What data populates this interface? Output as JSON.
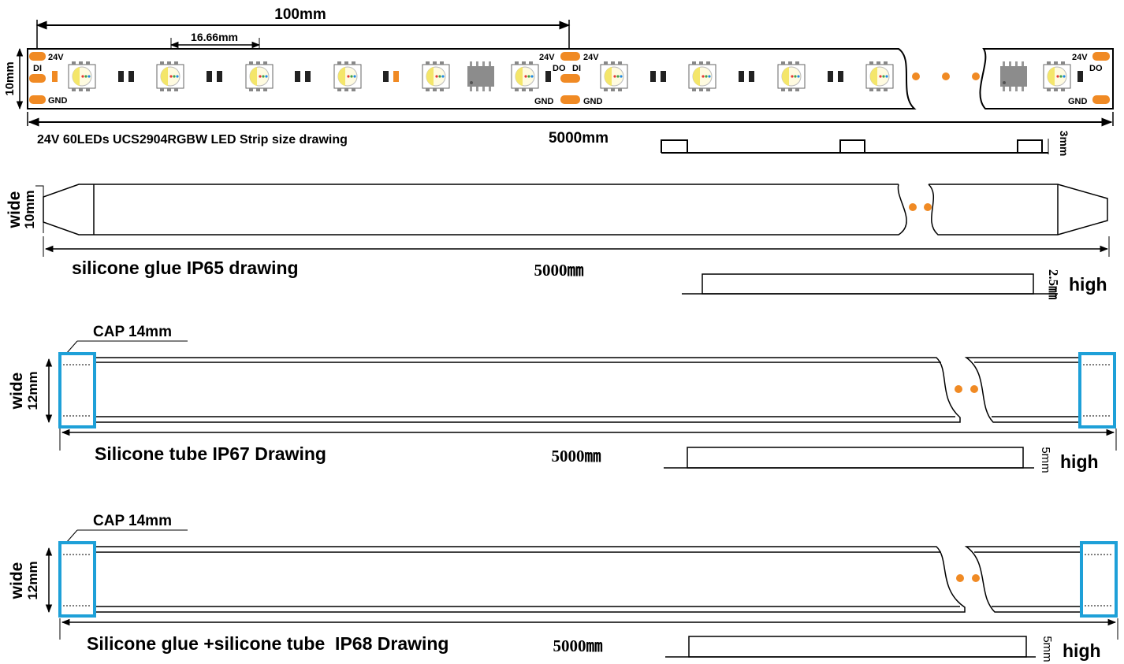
{
  "strip": {
    "dim_100": "100mm",
    "dim_pitch": "16.66mm",
    "dim_width": "10mm",
    "dim_total": "5000mm",
    "dim_thickness": "3mm",
    "caption": "24V 60LEDs UCS2904RGBW LED Strip size drawing",
    "pad_24v": "24V",
    "pad_di": "DI",
    "pad_do": "DO",
    "pad_gnd": "GND"
  },
  "ip65": {
    "width_value": "10mm",
    "width_word": "wide",
    "title": "silicone glue IP65 drawing",
    "length": "5000㎜",
    "height_value": "2.5㎜",
    "height_word": "high"
  },
  "ip67": {
    "cap": "CAP 14mm",
    "width_value": "12mm",
    "width_word": "wide",
    "title": "Silicone tube IP67 Drawing",
    "length": "5000㎜",
    "height_value": "5mm",
    "height_word": "high"
  },
  "ip68": {
    "cap": "CAP 14mm",
    "width_value": "12mm",
    "width_word": "wide",
    "title": "Silicone glue +silicone tube  IP68 Drawing",
    "length": "5000㎜",
    "height_value": "5mm",
    "height_word": "high"
  },
  "colors": {
    "pad": "#f08a24",
    "cap": "#1ea0d8",
    "line": "#000000",
    "ic": "#8c8c8c"
  }
}
